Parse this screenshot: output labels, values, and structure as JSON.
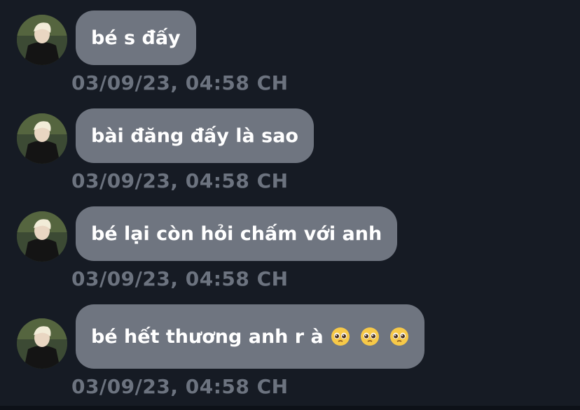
{
  "messages": [
    {
      "text": "bé s đấy",
      "timestamp": "03/09/23, 04:58 CH",
      "emojis": []
    },
    {
      "text": "bài đăng đấy là sao",
      "timestamp": "03/09/23, 04:58 CH",
      "emojis": []
    },
    {
      "text": "bé lại còn hỏi chấm với anh",
      "timestamp": "03/09/23, 04:58 CH",
      "emojis": []
    },
    {
      "text": "bé hết thương anh r à",
      "timestamp": "03/09/23, 04:58 CH",
      "emojis": [
        "pleading-face-icon",
        "pleading-face-icon",
        "pleading-face-icon"
      ]
    }
  ],
  "colors": {
    "background": "#161b24",
    "bubble": "#6f7580",
    "timestamp": "#6c737f",
    "text": "#ffffff"
  }
}
